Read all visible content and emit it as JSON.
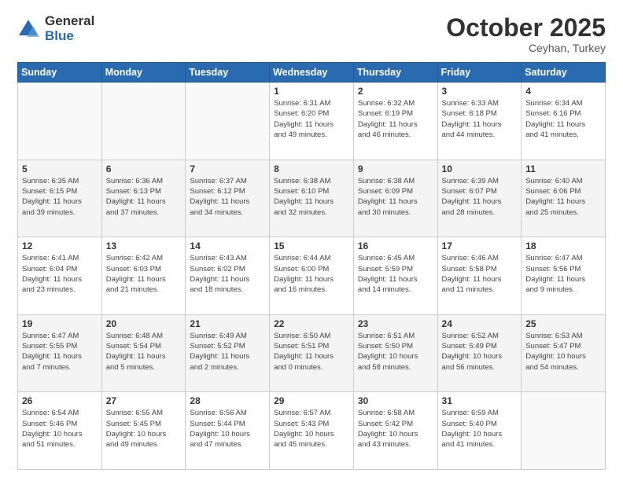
{
  "logo": {
    "general": "General",
    "blue": "Blue"
  },
  "header": {
    "month": "October 2025",
    "location": "Ceyhan, Turkey"
  },
  "weekdays": [
    "Sunday",
    "Monday",
    "Tuesday",
    "Wednesday",
    "Thursday",
    "Friday",
    "Saturday"
  ],
  "weeks": [
    [
      {
        "day": "",
        "info": ""
      },
      {
        "day": "",
        "info": ""
      },
      {
        "day": "",
        "info": ""
      },
      {
        "day": "1",
        "info": "Sunrise: 6:31 AM\nSunset: 6:20 PM\nDaylight: 11 hours\nand 49 minutes."
      },
      {
        "day": "2",
        "info": "Sunrise: 6:32 AM\nSunset: 6:19 PM\nDaylight: 11 hours\nand 46 minutes."
      },
      {
        "day": "3",
        "info": "Sunrise: 6:33 AM\nSunset: 6:18 PM\nDaylight: 11 hours\nand 44 minutes."
      },
      {
        "day": "4",
        "info": "Sunrise: 6:34 AM\nSunset: 6:16 PM\nDaylight: 11 hours\nand 41 minutes."
      }
    ],
    [
      {
        "day": "5",
        "info": "Sunrise: 6:35 AM\nSunset: 6:15 PM\nDaylight: 11 hours\nand 39 minutes."
      },
      {
        "day": "6",
        "info": "Sunrise: 6:36 AM\nSunset: 6:13 PM\nDaylight: 11 hours\nand 37 minutes."
      },
      {
        "day": "7",
        "info": "Sunrise: 6:37 AM\nSunset: 6:12 PM\nDaylight: 11 hours\nand 34 minutes."
      },
      {
        "day": "8",
        "info": "Sunrise: 6:38 AM\nSunset: 6:10 PM\nDaylight: 11 hours\nand 32 minutes."
      },
      {
        "day": "9",
        "info": "Sunrise: 6:38 AM\nSunset: 6:09 PM\nDaylight: 11 hours\nand 30 minutes."
      },
      {
        "day": "10",
        "info": "Sunrise: 6:39 AM\nSunset: 6:07 PM\nDaylight: 11 hours\nand 28 minutes."
      },
      {
        "day": "11",
        "info": "Sunrise: 6:40 AM\nSunset: 6:06 PM\nDaylight: 11 hours\nand 25 minutes."
      }
    ],
    [
      {
        "day": "12",
        "info": "Sunrise: 6:41 AM\nSunset: 6:04 PM\nDaylight: 11 hours\nand 23 minutes."
      },
      {
        "day": "13",
        "info": "Sunrise: 6:42 AM\nSunset: 6:03 PM\nDaylight: 11 hours\nand 21 minutes."
      },
      {
        "day": "14",
        "info": "Sunrise: 6:43 AM\nSunset: 6:02 PM\nDaylight: 11 hours\nand 18 minutes."
      },
      {
        "day": "15",
        "info": "Sunrise: 6:44 AM\nSunset: 6:00 PM\nDaylight: 11 hours\nand 16 minutes."
      },
      {
        "day": "16",
        "info": "Sunrise: 6:45 AM\nSunset: 5:59 PM\nDaylight: 11 hours\nand 14 minutes."
      },
      {
        "day": "17",
        "info": "Sunrise: 6:46 AM\nSunset: 5:58 PM\nDaylight: 11 hours\nand 11 minutes."
      },
      {
        "day": "18",
        "info": "Sunrise: 6:47 AM\nSunset: 5:56 PM\nDaylight: 11 hours\nand 9 minutes."
      }
    ],
    [
      {
        "day": "19",
        "info": "Sunrise: 6:47 AM\nSunset: 5:55 PM\nDaylight: 11 hours\nand 7 minutes."
      },
      {
        "day": "20",
        "info": "Sunrise: 6:48 AM\nSunset: 5:54 PM\nDaylight: 11 hours\nand 5 minutes."
      },
      {
        "day": "21",
        "info": "Sunrise: 6:49 AM\nSunset: 5:52 PM\nDaylight: 11 hours\nand 2 minutes."
      },
      {
        "day": "22",
        "info": "Sunrise: 6:50 AM\nSunset: 5:51 PM\nDaylight: 11 hours\nand 0 minutes."
      },
      {
        "day": "23",
        "info": "Sunrise: 6:51 AM\nSunset: 5:50 PM\nDaylight: 10 hours\nand 58 minutes."
      },
      {
        "day": "24",
        "info": "Sunrise: 6:52 AM\nSunset: 5:49 PM\nDaylight: 10 hours\nand 56 minutes."
      },
      {
        "day": "25",
        "info": "Sunrise: 6:53 AM\nSunset: 5:47 PM\nDaylight: 10 hours\nand 54 minutes."
      }
    ],
    [
      {
        "day": "26",
        "info": "Sunrise: 6:54 AM\nSunset: 5:46 PM\nDaylight: 10 hours\nand 51 minutes."
      },
      {
        "day": "27",
        "info": "Sunrise: 6:55 AM\nSunset: 5:45 PM\nDaylight: 10 hours\nand 49 minutes."
      },
      {
        "day": "28",
        "info": "Sunrise: 6:56 AM\nSunset: 5:44 PM\nDaylight: 10 hours\nand 47 minutes."
      },
      {
        "day": "29",
        "info": "Sunrise: 6:57 AM\nSunset: 5:43 PM\nDaylight: 10 hours\nand 45 minutes."
      },
      {
        "day": "30",
        "info": "Sunrise: 6:58 AM\nSunset: 5:42 PM\nDaylight: 10 hours\nand 43 minutes."
      },
      {
        "day": "31",
        "info": "Sunrise: 6:59 AM\nSunset: 5:40 PM\nDaylight: 10 hours\nand 41 minutes."
      },
      {
        "day": "",
        "info": ""
      }
    ]
  ]
}
